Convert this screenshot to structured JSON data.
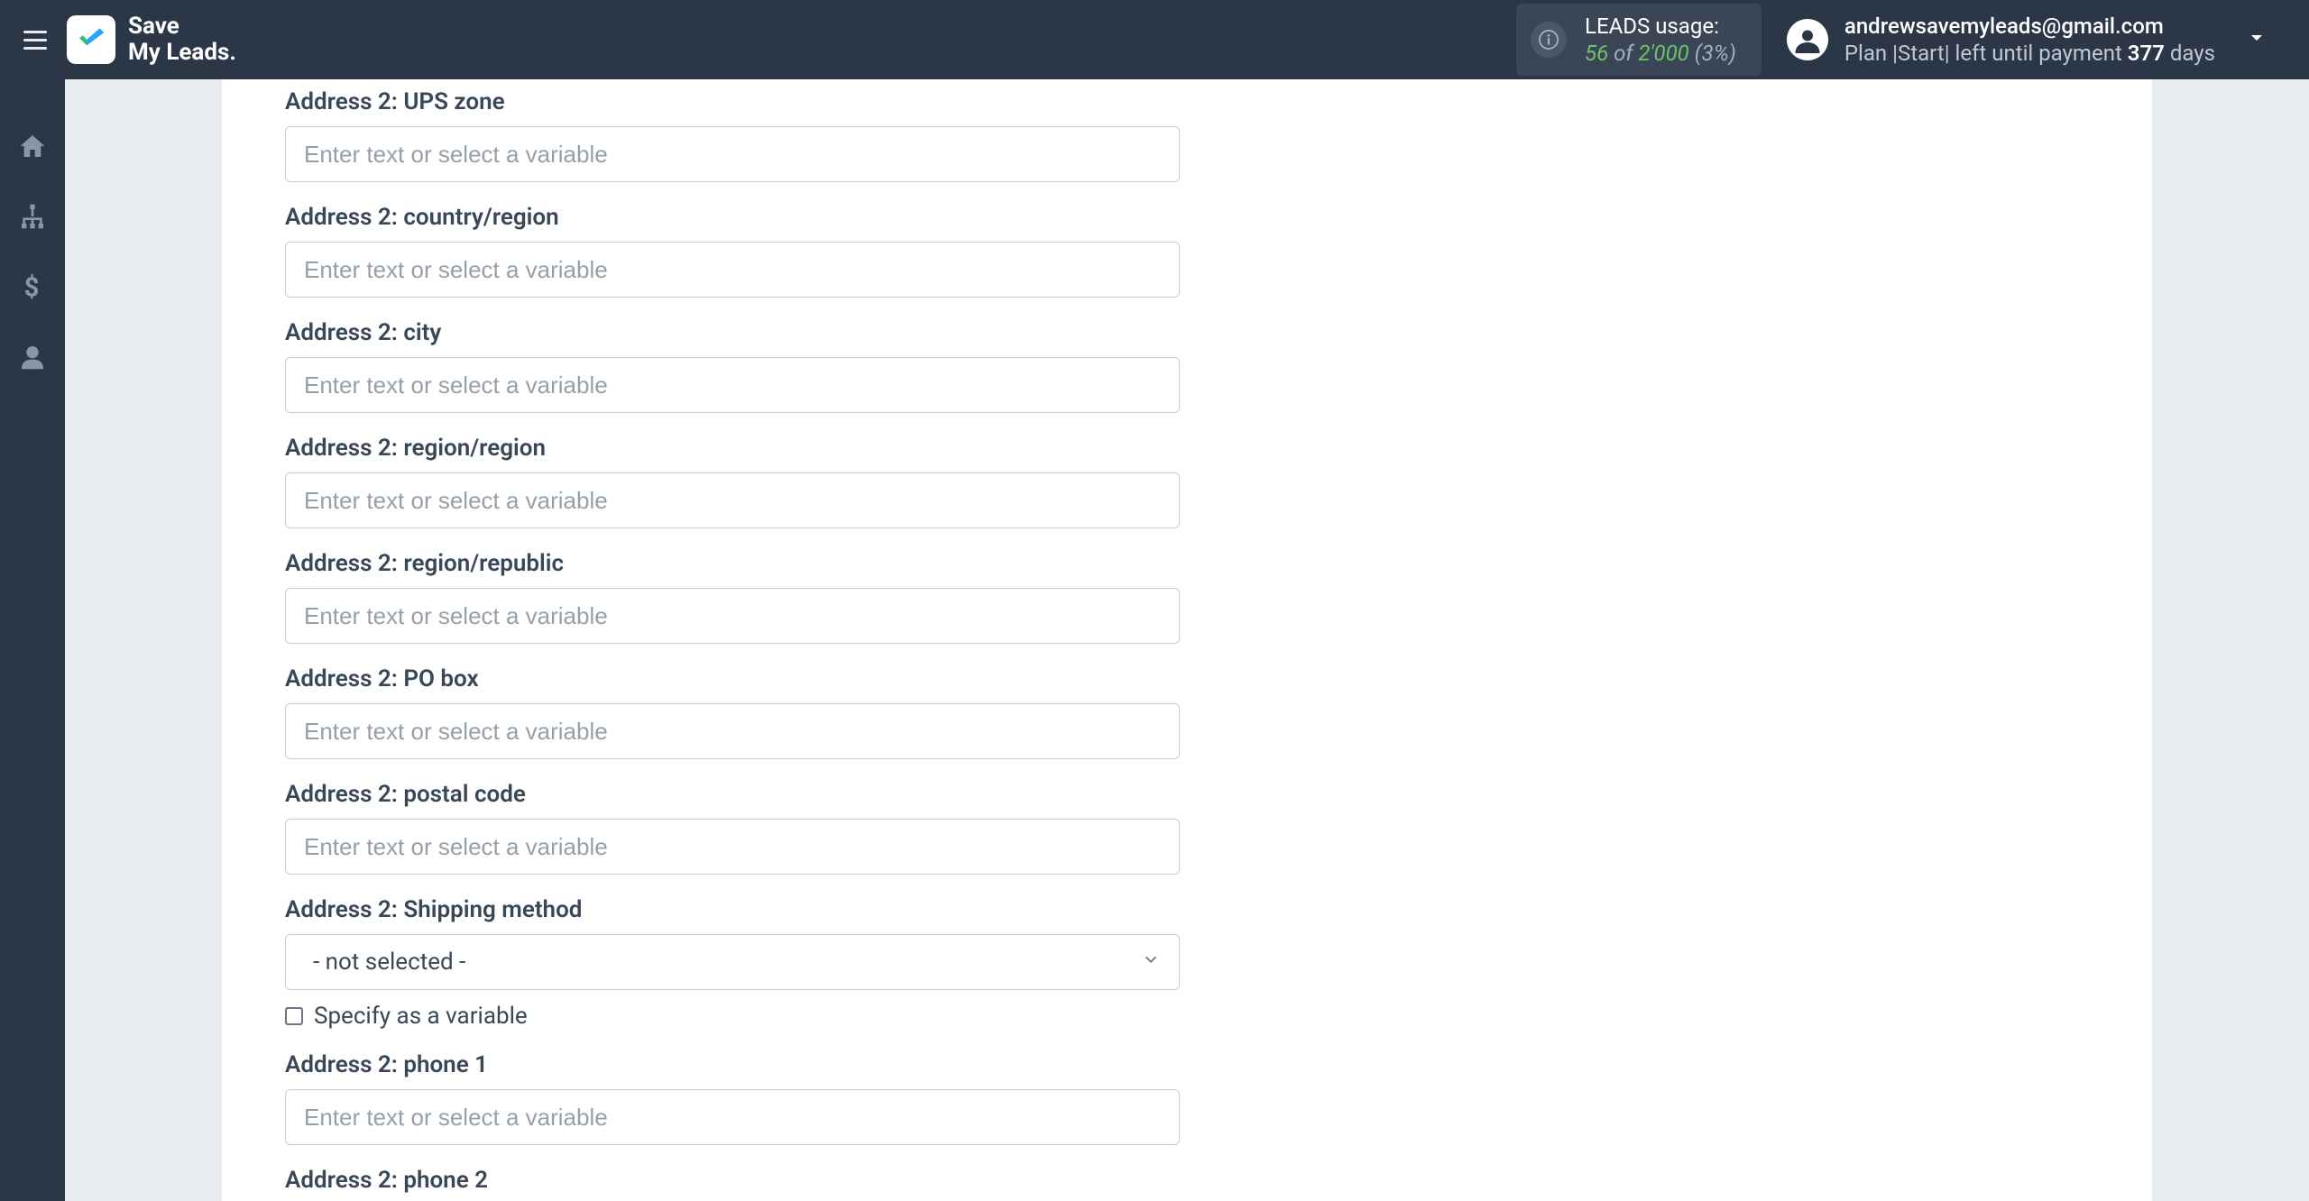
{
  "header": {
    "logo_line1": "Save",
    "logo_line2": "My Leads."
  },
  "leads_usage": {
    "title": "LEADS usage:",
    "used": "56",
    "of": "of",
    "total": "2'000",
    "pct": "(3%)"
  },
  "user": {
    "email": "andrewsavemyleads@gmail.com",
    "plan_prefix": "Plan |",
    "plan_name": "Start",
    "plan_mid": "| left until payment ",
    "days": "377",
    "days_suffix": " days"
  },
  "form": {
    "placeholder": "Enter text or select a variable",
    "fields": [
      {
        "label": "Address 2: UPS zone",
        "type": "text"
      },
      {
        "label": "Address 2: country/region",
        "type": "text"
      },
      {
        "label": "Address 2: city",
        "type": "text"
      },
      {
        "label": "Address 2: region/region",
        "type": "text"
      },
      {
        "label": "Address 2: region/republic",
        "type": "text"
      },
      {
        "label": "Address 2: PO box",
        "type": "text"
      },
      {
        "label": "Address 2: postal code",
        "type": "text"
      },
      {
        "label": "Address 2: Shipping method",
        "type": "select",
        "selected": "- not selected -",
        "checkbox": "Specify as a variable"
      },
      {
        "label": "Address 2: phone 1",
        "type": "text"
      },
      {
        "label": "Address 2: phone 2",
        "type": "label-only"
      }
    ]
  }
}
